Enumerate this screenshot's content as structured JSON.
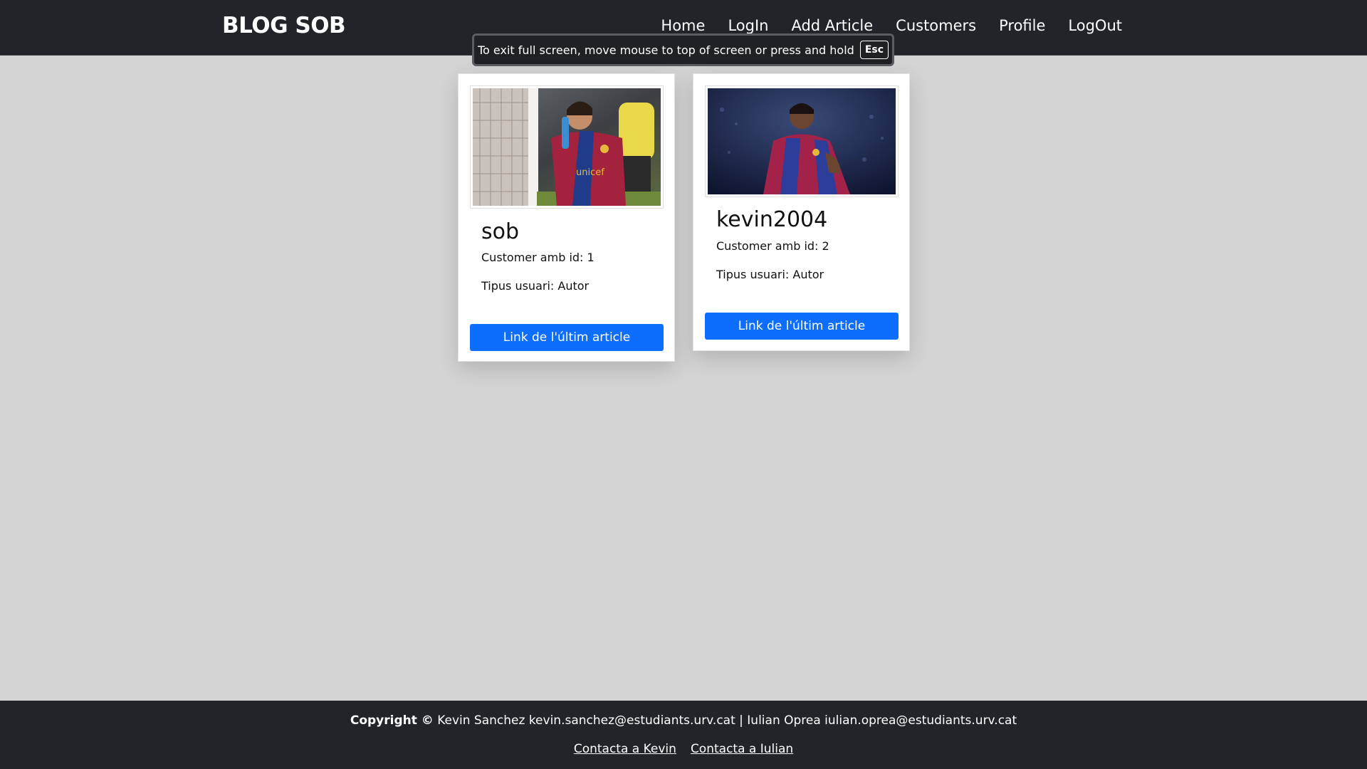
{
  "header": {
    "brand": "BLOG SOB",
    "nav": [
      "Home",
      "LogIn",
      "Add Article",
      "Customers",
      "Profile",
      "LogOut"
    ]
  },
  "fullscreen_notice": {
    "message": "To exit full screen, move mouse to top of screen or press and hold",
    "key": "Esc"
  },
  "customers": [
    {
      "name": "sob",
      "id_line": "Customer amb id: 1",
      "type_line": "Tipus usuari: Autor",
      "button": "Link de l'últim article",
      "image": "player-photo-red-blue-kit"
    },
    {
      "name": "kevin2004",
      "id_line": "Customer amb id: 2",
      "type_line": "Tipus usuari: Autor",
      "button": "Link de l'últim article",
      "image": "player-photo-night-stadium"
    }
  ],
  "footer": {
    "copyright_label": "Copyright ©",
    "copyright_text": " Kevin Sanchez kevin.sanchez@estudiants.urv.cat | Iulian Oprea iulian.oprea@estudiants.urv.cat",
    "links": [
      "Contacta a Kevin",
      "Contacta a Iulian"
    ]
  },
  "colors": {
    "navbar": "#212429",
    "background": "#d4d4d4",
    "primary_button": "#0d6efd"
  }
}
